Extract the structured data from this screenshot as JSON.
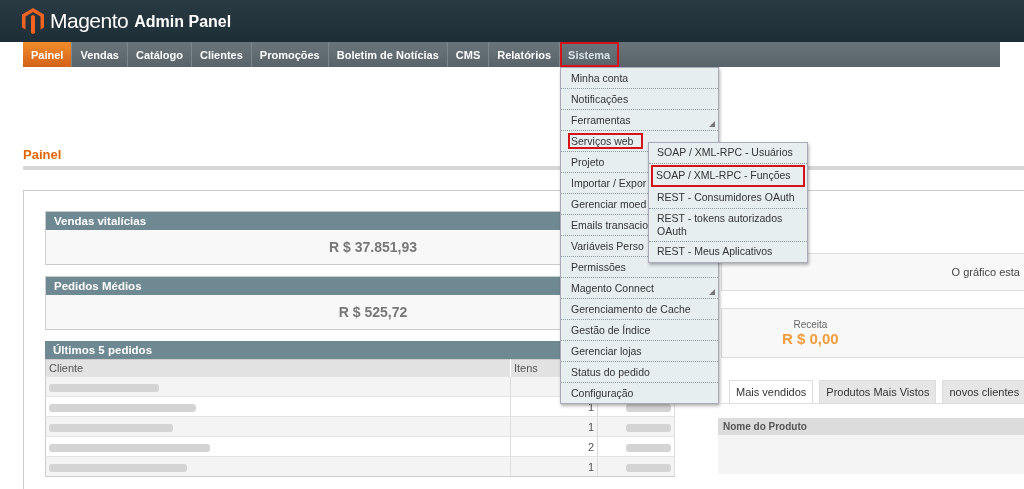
{
  "header": {
    "logo_text": "Magento",
    "logo_suffix": "Admin Panel"
  },
  "nav": [
    {
      "label": "Painel",
      "selected": true,
      "highlighted": false
    },
    {
      "label": "Vendas",
      "selected": false,
      "highlighted": false
    },
    {
      "label": "Catálogo",
      "selected": false,
      "highlighted": false
    },
    {
      "label": "Clientes",
      "selected": false,
      "highlighted": false
    },
    {
      "label": "Promoções",
      "selected": false,
      "highlighted": false
    },
    {
      "label": "Boletim de Notícias",
      "selected": false,
      "highlighted": false
    },
    {
      "label": "CMS",
      "selected": false,
      "highlighted": false
    },
    {
      "label": "Relatórios",
      "selected": false,
      "highlighted": false
    },
    {
      "label": "Sistema",
      "selected": false,
      "highlighted": true
    }
  ],
  "dropdown": [
    {
      "label": "Minha conta",
      "highlighted": false,
      "has_submenu": false
    },
    {
      "label": "Notificações",
      "highlighted": false,
      "has_submenu": false
    },
    {
      "label": "Ferramentas",
      "highlighted": false,
      "has_submenu": true
    },
    {
      "label": "Serviços web",
      "highlighted": true,
      "has_submenu": false
    },
    {
      "label": "Projeto",
      "highlighted": false,
      "has_submenu": false
    },
    {
      "label": "Importar / Expor",
      "highlighted": false,
      "has_submenu": false
    },
    {
      "label": "Gerenciar moed",
      "highlighted": false,
      "has_submenu": false
    },
    {
      "label": "Emails transacio",
      "highlighted": false,
      "has_submenu": false
    },
    {
      "label": "Variáveis Perso",
      "highlighted": false,
      "has_submenu": false
    },
    {
      "label": "Permissões",
      "highlighted": false,
      "has_submenu": false
    },
    {
      "label": "Magento Connect",
      "highlighted": false,
      "has_submenu": true
    },
    {
      "label": "Gerenciamento de Cache",
      "highlighted": false,
      "has_submenu": false
    },
    {
      "label": "Gestão de Índice",
      "highlighted": false,
      "has_submenu": false
    },
    {
      "label": "Gerenciar lojas",
      "highlighted": false,
      "has_submenu": false
    },
    {
      "label": "Status do pedido",
      "highlighted": false,
      "has_submenu": false
    },
    {
      "label": "Configuração",
      "highlighted": false,
      "has_submenu": false
    }
  ],
  "submenu": [
    {
      "label": "SOAP / XML-RPC - Usuários",
      "highlighted": false
    },
    {
      "label": "SOAP / XML-RPC - Funções",
      "highlighted": true
    },
    {
      "label": "REST - Consumidores OAuth",
      "highlighted": false
    },
    {
      "label": "REST - tokens autorizados OAuth",
      "highlighted": false
    },
    {
      "label": "REST - Meus Aplicativos",
      "highlighted": false
    }
  ],
  "page_title": "Painel",
  "cards": [
    {
      "title": "Vendas vitalícias",
      "value": "R $ 37.851,93"
    },
    {
      "title": "Pedidos Médios",
      "value": "R $ 525,72"
    }
  ],
  "orders": {
    "title": "Últimos 5 pedidos",
    "columns": [
      "Cliente",
      "Itens"
    ],
    "rows": [
      {},
      {
        "items": "1"
      },
      {
        "items": "1"
      },
      {
        "items": "2"
      },
      {
        "items": "1"
      }
    ]
  },
  "chart_panel": {
    "message": "O gráfico esta"
  },
  "totals": [
    {
      "label": "Receita",
      "value": "R $ 0,00"
    }
  ],
  "grid_tabs": [
    {
      "label": "Mais vendidos",
      "selected": true
    },
    {
      "label": "Produtos Mais Vistos",
      "selected": false
    },
    {
      "label": "novos clientes",
      "selected": false
    }
  ],
  "grid": {
    "columns": [
      "Nome do Produto"
    ]
  }
}
